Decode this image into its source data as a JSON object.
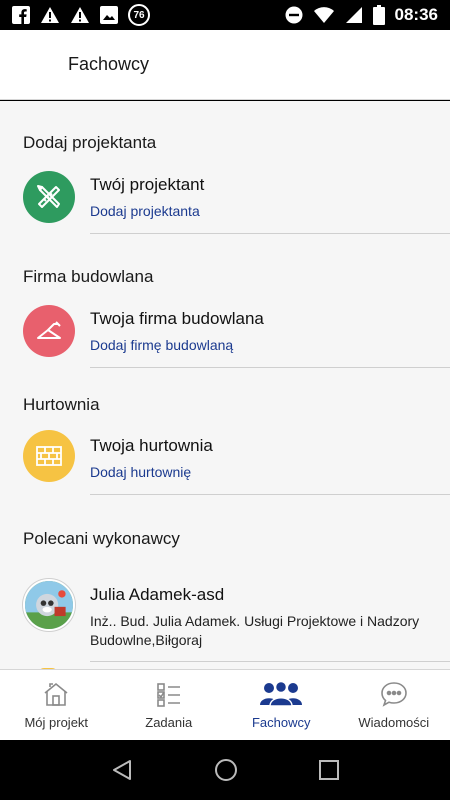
{
  "status_bar": {
    "time": "08:36",
    "notification_badge": "76",
    "icons": [
      "facebook-icon",
      "warning-icon",
      "warning-icon",
      "image-icon",
      "badge-icon",
      "do-not-disturb-icon",
      "wifi-icon",
      "signal-icon",
      "battery-icon"
    ]
  },
  "header": {
    "title": "Fachowcy"
  },
  "sections": [
    {
      "header": "Dodaj projektanta",
      "item": {
        "title": "Twój projektant",
        "link": "Dodaj projektanta",
        "icon": "ruler-pencil-icon",
        "color": "#2e9b5f"
      }
    },
    {
      "header": "Firma budowlana",
      "item": {
        "title": "Twoja firma budowlana",
        "link": "Dodaj firmę budowlaną",
        "icon": "trowel-icon",
        "color": "#e8606d"
      }
    },
    {
      "header": "Hurtownia",
      "item": {
        "title": "Twoja hurtownia",
        "link": "Dodaj hurtownię",
        "icon": "bricks-icon",
        "color": "#f6c343"
      }
    },
    {
      "header": "Polecani wykonawcy",
      "item": {
        "title": "Julia Adamek-asd",
        "subtitle": "Inż.. Bud. Julia Adamek. Usługi Projektowe i Nadzory Budowlne,Biłgoraj",
        "icon": "avatar"
      }
    }
  ],
  "bottom_nav": [
    {
      "label": "Mój projekt",
      "icon": "house-icon",
      "active": false
    },
    {
      "label": "Zadania",
      "icon": "checklist-icon",
      "active": false
    },
    {
      "label": "Fachowcy",
      "icon": "people-icon",
      "active": true
    },
    {
      "label": "Wiadomości",
      "icon": "chat-icon",
      "active": false
    }
  ],
  "colors": {
    "accent": "#1b3a8f",
    "inactive": "#8a8a8a"
  }
}
